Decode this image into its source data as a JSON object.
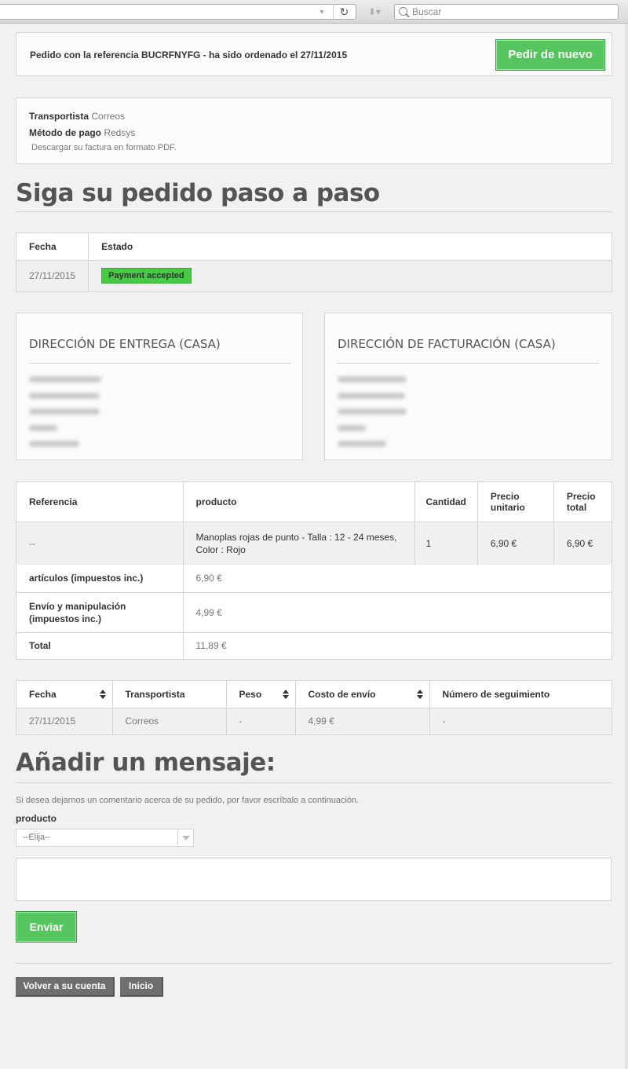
{
  "browser": {
    "search_placeholder": "Buscar"
  },
  "order_header": {
    "text": "Pedido con la referencia BUCRFNYFG - ha sido ordenado el 27/11/2015",
    "reorder_label": "Pedir de nuevo"
  },
  "order_info": {
    "carrier_label": "Transportista",
    "carrier_value": "Correos",
    "payment_label": "Método de pago",
    "payment_value": "Redsys",
    "invoice_text": "Descargar su factura en formato PDF."
  },
  "follow": {
    "heading": "Siga su pedido paso a paso",
    "headers": [
      "Fecha",
      "Estado"
    ],
    "date": "27/11/2015",
    "status": "Payment accepted",
    "status_color": "#46cb44"
  },
  "addresses": {
    "delivery_title": "Dirección de entrega (Casa)",
    "invoice_title": "Dirección de facturación (Casa)"
  },
  "products": {
    "headers": [
      "Referencia",
      "producto",
      "Cantidad",
      "Precio unitario",
      "Precio total"
    ],
    "rows": [
      {
        "reference": "--",
        "product": "Manoplas rojas de punto - Talla : 12 - 24 meses, Color : Rojo",
        "quantity": "1",
        "unit_price": "6,90 €",
        "total_price": "6,90 €"
      }
    ],
    "totals": [
      {
        "label": "artículos (impuestos inc.)",
        "value": "6,90 €"
      },
      {
        "label": "Envío y manipulación (impuestos inc.)",
        "value": "4,99 €"
      },
      {
        "label": "Total",
        "value": "11,89 €"
      }
    ]
  },
  "shipping": {
    "headers": [
      "Fecha",
      "Transportista",
      "Peso",
      "Costo de envío",
      "Número de seguimiento"
    ],
    "row": {
      "date": "27/11/2015",
      "carrier": "Correos",
      "weight": "-",
      "cost": "4,99 €",
      "tracking": "-"
    }
  },
  "message": {
    "heading": "Añadir un mensaje:",
    "intro": "Si desea dejarnos un comentario acerca de su pedido, por favor escríbalo a continuación.",
    "product_label": "producto",
    "select_value": "--Elija--",
    "send_label": "Enviar"
  },
  "footer_nav": {
    "back_label": "Volver a su cuenta",
    "home_label": "Inicio"
  },
  "colors": {
    "accent_green": "#55c65e",
    "link_blue": "#3d7ba8"
  }
}
